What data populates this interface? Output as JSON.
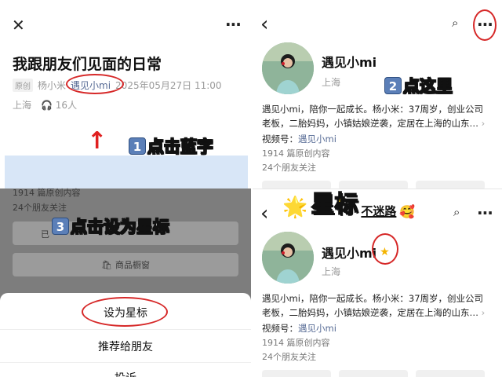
{
  "left": {
    "close_glyph": "✕",
    "more_glyph": "···",
    "article_title": "我跟朋友们见面的日常",
    "original_badge": "原创",
    "author": "杨小米",
    "account_link": "遇见小mi",
    "date": "2025年05月27日 11:00",
    "location": "上海",
    "listeners": "16人",
    "arrow_glyph": "↑",
    "step1_num": "1",
    "step1_text": "点击蓝字",
    "overlay_posts": "1914 篇原创内容",
    "overlay_friends": "24个朋友关注",
    "overlay_partial": "已",
    "step3_num": "3",
    "step3_text": "点击设为星标",
    "shop_window": "商品橱窗",
    "sheet": {
      "set_star": "设为星标",
      "recommend": "推荐给朋友",
      "partial_item": "投诉"
    }
  },
  "right_top": {
    "back_glyph": "‹",
    "search_glyph": "⌕",
    "more_glyph": "···",
    "name": "遇见小mi",
    "location": "上海",
    "step2_num": "2",
    "step2_text": "点这里",
    "bio_line1": "遇见小mi，陪你一起成长。杨小米：37周岁，创业公司",
    "bio_line2": "老板，二胎妈妈，小镇姑娘逆袭，定居在上海的山东…",
    "video_label": "视频号：",
    "video_name": "遇见小mi",
    "posts": "1914 篇原创内容",
    "friends": "24个朋友关注"
  },
  "right_bottom": {
    "back_glyph": "‹",
    "search_glyph": "⌕",
    "more_glyph": "···",
    "banner_star": "🌟",
    "banner_main": "星标",
    "banner_sub": "不迷路",
    "banner_emoji": "🥰",
    "name": "遇见小mi",
    "star_glyph": "★",
    "location": "上海",
    "bio_line1": "遇见小mi，陪你一起成长。杨小米：37周岁，创业公司",
    "bio_line2": "老板，二胎妈妈，小镇姑娘逆袭，定居在上海的山东…",
    "video_label": "视频号：",
    "video_name": "遇见小mi",
    "posts": "1914 篇原创内容",
    "friends": "24个朋友关注"
  },
  "colors": {
    "link_blue": "#576b95",
    "highlight_red": "#d62828",
    "star_yellow": "#f4b400"
  }
}
